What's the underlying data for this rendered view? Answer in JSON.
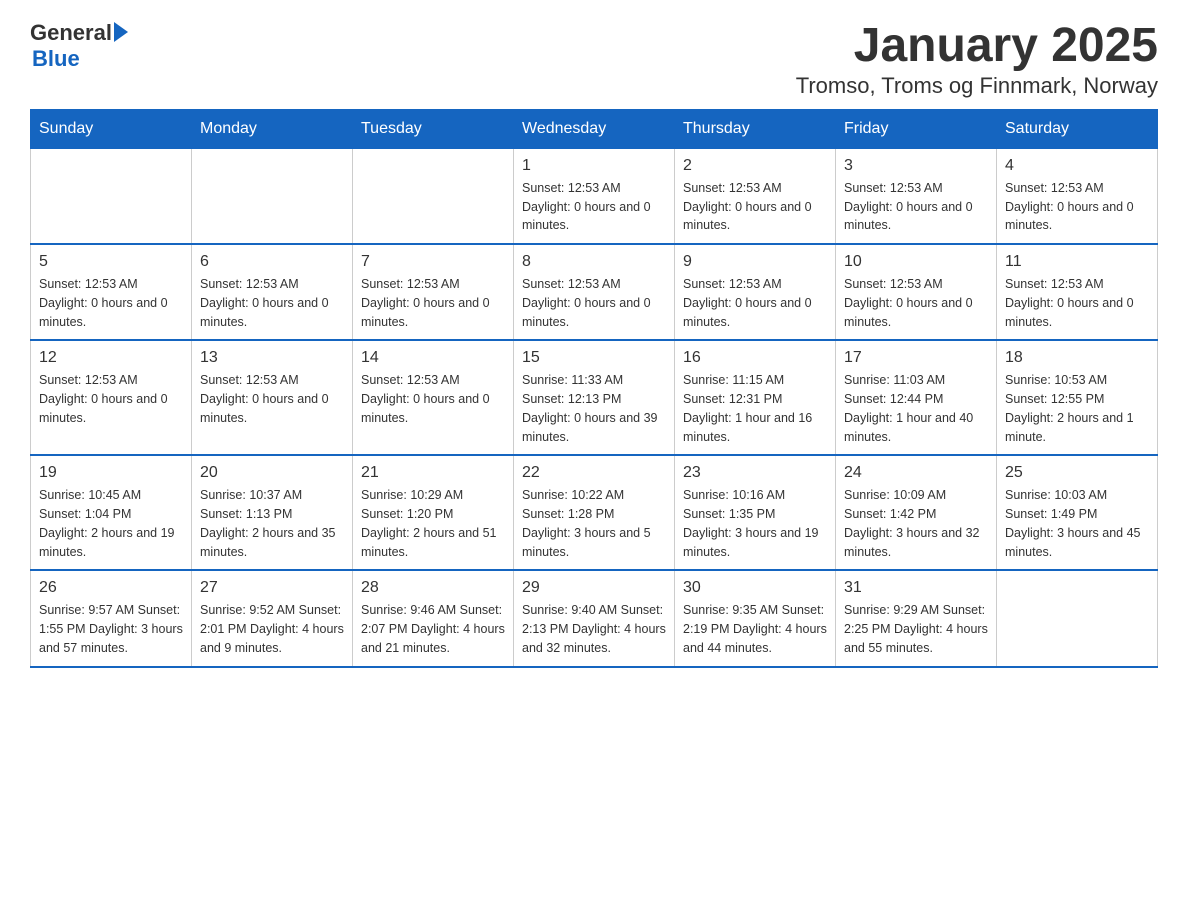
{
  "logo": {
    "general": "General",
    "blue": "Blue",
    "arrow": "▶"
  },
  "title": "January 2025",
  "subtitle": "Tromso, Troms og Finnmark, Norway",
  "headers": [
    "Sunday",
    "Monday",
    "Tuesday",
    "Wednesday",
    "Thursday",
    "Friday",
    "Saturday"
  ],
  "weeks": [
    [
      {
        "day": "",
        "info": ""
      },
      {
        "day": "",
        "info": ""
      },
      {
        "day": "",
        "info": ""
      },
      {
        "day": "1",
        "info": "Sunset: 12:53 AM\nDaylight: 0 hours\nand 0 minutes."
      },
      {
        "day": "2",
        "info": "Sunset: 12:53 AM\nDaylight: 0 hours\nand 0 minutes."
      },
      {
        "day": "3",
        "info": "Sunset: 12:53 AM\nDaylight: 0 hours\nand 0 minutes."
      },
      {
        "day": "4",
        "info": "Sunset: 12:53 AM\nDaylight: 0 hours\nand 0 minutes."
      }
    ],
    [
      {
        "day": "5",
        "info": "Sunset: 12:53 AM\nDaylight: 0 hours\nand 0 minutes."
      },
      {
        "day": "6",
        "info": "Sunset: 12:53 AM\nDaylight: 0 hours\nand 0 minutes."
      },
      {
        "day": "7",
        "info": "Sunset: 12:53 AM\nDaylight: 0 hours\nand 0 minutes."
      },
      {
        "day": "8",
        "info": "Sunset: 12:53 AM\nDaylight: 0 hours\nand 0 minutes."
      },
      {
        "day": "9",
        "info": "Sunset: 12:53 AM\nDaylight: 0 hours\nand 0 minutes."
      },
      {
        "day": "10",
        "info": "Sunset: 12:53 AM\nDaylight: 0 hours\nand 0 minutes."
      },
      {
        "day": "11",
        "info": "Sunset: 12:53 AM\nDaylight: 0 hours\nand 0 minutes."
      }
    ],
    [
      {
        "day": "12",
        "info": "Sunset: 12:53 AM\nDaylight: 0 hours\nand 0 minutes."
      },
      {
        "day": "13",
        "info": "Sunset: 12:53 AM\nDaylight: 0 hours\nand 0 minutes."
      },
      {
        "day": "14",
        "info": "Sunset: 12:53 AM\nDaylight: 0 hours\nand 0 minutes."
      },
      {
        "day": "15",
        "info": "Sunrise: 11:33 AM\nSunset: 12:13 PM\nDaylight: 0 hours\nand 39 minutes."
      },
      {
        "day": "16",
        "info": "Sunrise: 11:15 AM\nSunset: 12:31 PM\nDaylight: 1 hour and\n16 minutes."
      },
      {
        "day": "17",
        "info": "Sunrise: 11:03 AM\nSunset: 12:44 PM\nDaylight: 1 hour and\n40 minutes."
      },
      {
        "day": "18",
        "info": "Sunrise: 10:53 AM\nSunset: 12:55 PM\nDaylight: 2 hours\nand 1 minute."
      }
    ],
    [
      {
        "day": "19",
        "info": "Sunrise: 10:45 AM\nSunset: 1:04 PM\nDaylight: 2 hours\nand 19 minutes."
      },
      {
        "day": "20",
        "info": "Sunrise: 10:37 AM\nSunset: 1:13 PM\nDaylight: 2 hours\nand 35 minutes."
      },
      {
        "day": "21",
        "info": "Sunrise: 10:29 AM\nSunset: 1:20 PM\nDaylight: 2 hours\nand 51 minutes."
      },
      {
        "day": "22",
        "info": "Sunrise: 10:22 AM\nSunset: 1:28 PM\nDaylight: 3 hours\nand 5 minutes."
      },
      {
        "day": "23",
        "info": "Sunrise: 10:16 AM\nSunset: 1:35 PM\nDaylight: 3 hours\nand 19 minutes."
      },
      {
        "day": "24",
        "info": "Sunrise: 10:09 AM\nSunset: 1:42 PM\nDaylight: 3 hours\nand 32 minutes."
      },
      {
        "day": "25",
        "info": "Sunrise: 10:03 AM\nSunset: 1:49 PM\nDaylight: 3 hours\nand 45 minutes."
      }
    ],
    [
      {
        "day": "26",
        "info": "Sunrise: 9:57 AM\nSunset: 1:55 PM\nDaylight: 3 hours\nand 57 minutes."
      },
      {
        "day": "27",
        "info": "Sunrise: 9:52 AM\nSunset: 2:01 PM\nDaylight: 4 hours\nand 9 minutes."
      },
      {
        "day": "28",
        "info": "Sunrise: 9:46 AM\nSunset: 2:07 PM\nDaylight: 4 hours\nand 21 minutes."
      },
      {
        "day": "29",
        "info": "Sunrise: 9:40 AM\nSunset: 2:13 PM\nDaylight: 4 hours\nand 32 minutes."
      },
      {
        "day": "30",
        "info": "Sunrise: 9:35 AM\nSunset: 2:19 PM\nDaylight: 4 hours\nand 44 minutes."
      },
      {
        "day": "31",
        "info": "Sunrise: 9:29 AM\nSunset: 2:25 PM\nDaylight: 4 hours\nand 55 minutes."
      },
      {
        "day": "",
        "info": ""
      }
    ]
  ]
}
